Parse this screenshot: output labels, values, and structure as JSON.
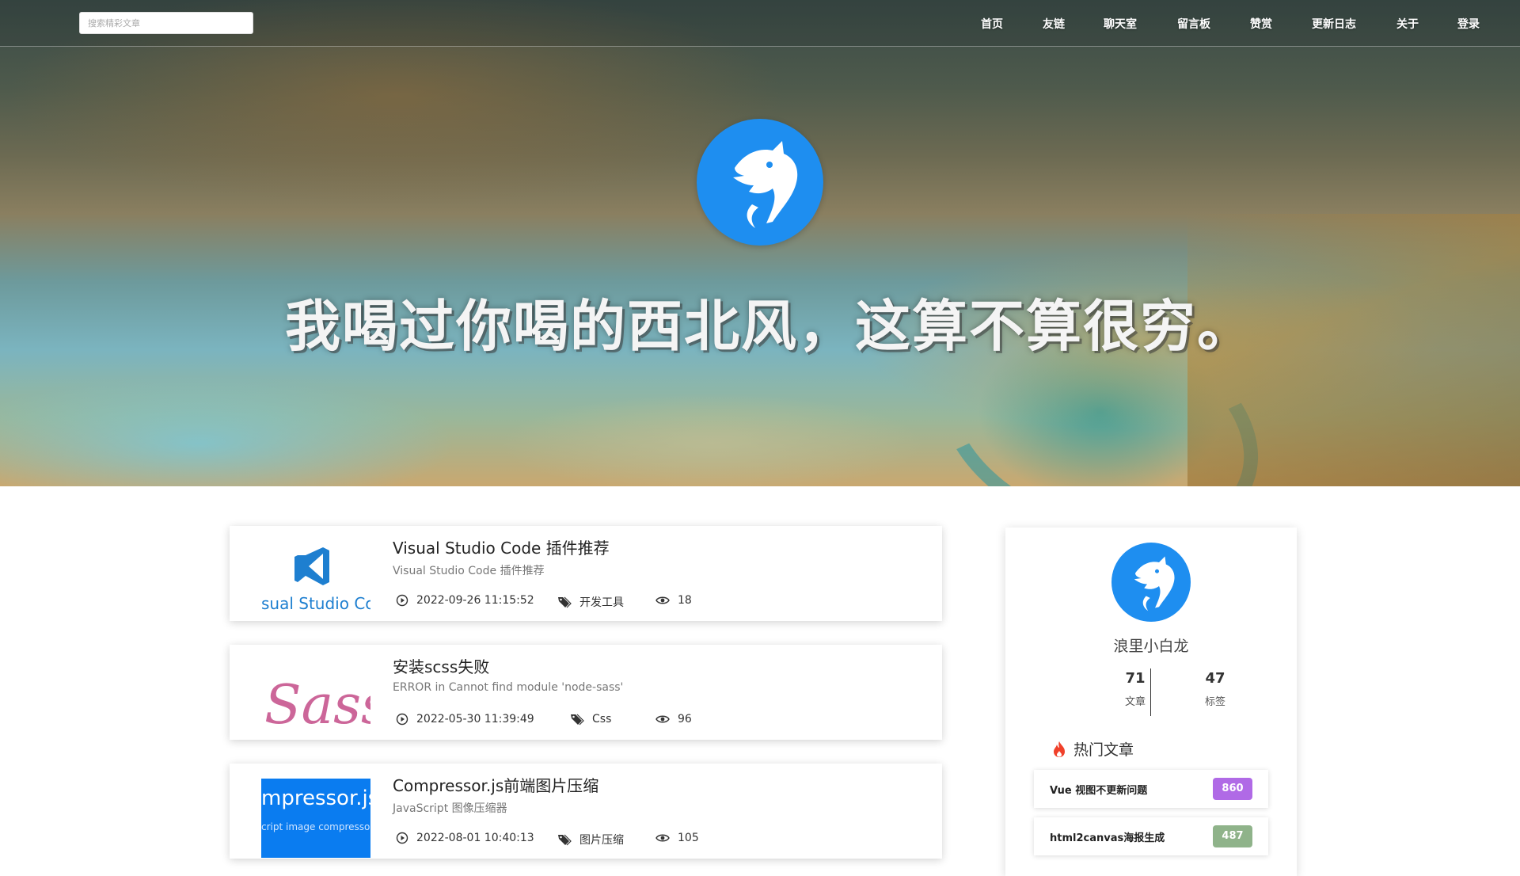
{
  "nav": {
    "search_placeholder": "搜索精彩文章",
    "items": [
      "首页",
      "友链",
      "聊天室",
      "留言板",
      "赞赏",
      "更新日志",
      "关于",
      "登录"
    ]
  },
  "hero": {
    "slogan": "我喝过你喝的西北风，这算不算很穷。"
  },
  "articles": [
    {
      "title": "Visual Studio Code 插件推荐",
      "desc": "Visual Studio Code 插件推荐",
      "date": "2022-09-26 11:15:52",
      "tag": "开发工具",
      "views": "18",
      "thumb_text": "sual Studio Coc"
    },
    {
      "title": "安装scss失败",
      "desc": "ERROR in Cannot find module 'node-sass'",
      "date": "2022-05-30 11:39:49",
      "tag": "Css",
      "views": "96",
      "thumb_text": "Sass"
    },
    {
      "title": "Compressor.js前端图片压缩",
      "desc": "JavaScript 图像压缩器",
      "date": "2022-08-01 10:40:13",
      "tag": "图片压缩",
      "views": "105",
      "thumb_text": "mpressor.js",
      "thumb_subtext": "cript image compressor"
    }
  ],
  "profile": {
    "name": "浪里小白龙",
    "articles_count": "71",
    "articles_label": "文章",
    "tags_count": "47",
    "tags_label": "标签"
  },
  "hot": {
    "title": "热门文章",
    "items": [
      {
        "label": "Vue 视图不更新问题",
        "count": "860",
        "color": "#b06ae6"
      },
      {
        "label": "html2canvas海报生成",
        "count": "487",
        "color": "#8fb38a"
      }
    ]
  },
  "colors": {
    "brand_blue": "#1e8ef0",
    "vscode_blue": "#1e7fd0",
    "sass_pink": "#cc6699",
    "compressor_blue": "#0a7cf0",
    "fire_red": "#f0402a"
  }
}
